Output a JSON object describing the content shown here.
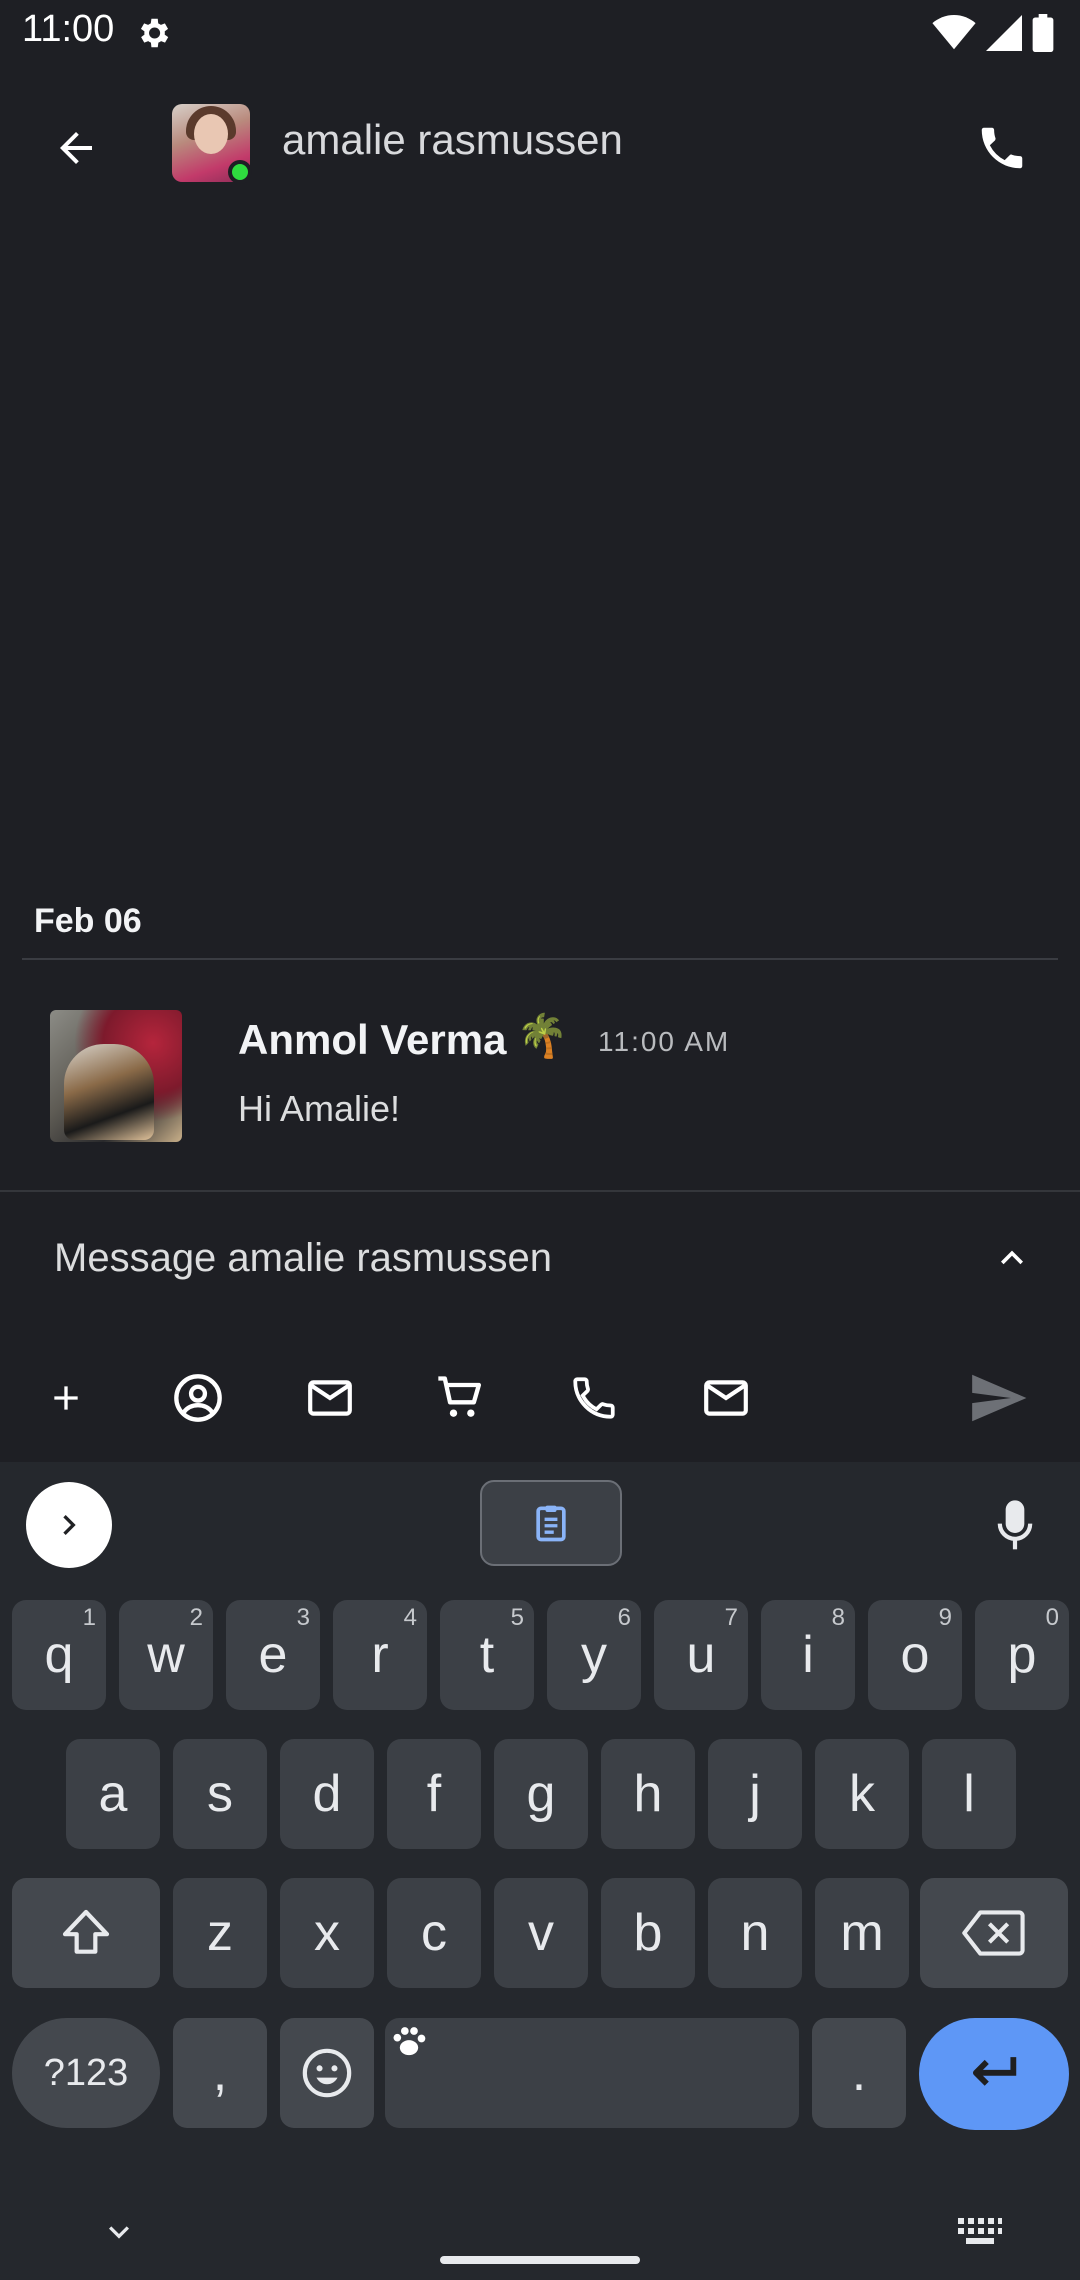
{
  "status_bar": {
    "time": "11:00"
  },
  "header": {
    "contact_name": "amalie rasmussen",
    "presence": "online"
  },
  "date_separator": "Feb 06",
  "message": {
    "author": "Anmol Verma",
    "author_emoji": "🌴",
    "time": "11:00 AM",
    "text": "Hi Amalie!"
  },
  "composer": {
    "placeholder": "Message amalie rasmussen",
    "tools": [
      "add-icon",
      "user-circle-icon",
      "mail-icon",
      "cart-icon",
      "phone-icon",
      "mail-icon"
    ]
  },
  "keyboard": {
    "row1": [
      {
        "key": "q",
        "hint": "1"
      },
      {
        "key": "w",
        "hint": "2"
      },
      {
        "key": "e",
        "hint": "3"
      },
      {
        "key": "r",
        "hint": "4"
      },
      {
        "key": "t",
        "hint": "5"
      },
      {
        "key": "y",
        "hint": "6"
      },
      {
        "key": "u",
        "hint": "7"
      },
      {
        "key": "i",
        "hint": "8"
      },
      {
        "key": "o",
        "hint": "9"
      },
      {
        "key": "p",
        "hint": "0"
      }
    ],
    "row2": [
      "a",
      "s",
      "d",
      "f",
      "g",
      "h",
      "j",
      "k",
      "l"
    ],
    "row3": [
      "z",
      "x",
      "c",
      "v",
      "b",
      "n",
      "m"
    ],
    "symbols_label": "?123",
    "comma": ",",
    "period": "."
  },
  "colors": {
    "background": "#1e1f24",
    "keyboard_bg": "#25282d",
    "key_bg": "#3c4046",
    "enter_key": "#5e97f6",
    "presence_online": "#2fdc3f"
  }
}
